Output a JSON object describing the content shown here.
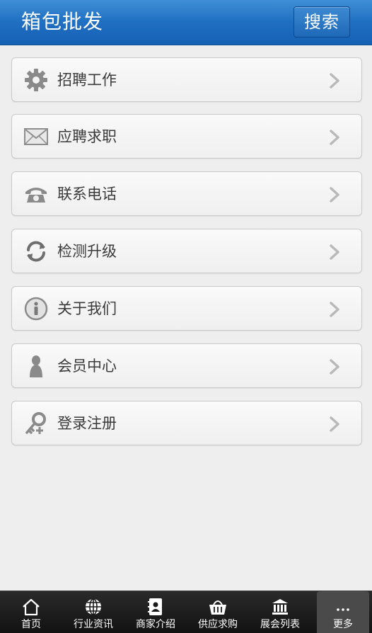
{
  "header": {
    "title": "箱包批发",
    "search_label": "搜索"
  },
  "menu": [
    {
      "label": "招聘工作",
      "icon": "gear-icon"
    },
    {
      "label": "应聘求职",
      "icon": "envelope-icon"
    },
    {
      "label": "联系电话",
      "icon": "telephone-icon"
    },
    {
      "label": "检测升级",
      "icon": "refresh-icon"
    },
    {
      "label": "关于我们",
      "icon": "info-icon"
    },
    {
      "label": "会员中心",
      "icon": "user-icon"
    },
    {
      "label": "登录注册",
      "icon": "key-icon"
    }
  ],
  "tabs": [
    {
      "label": "首页",
      "icon": "home-icon"
    },
    {
      "label": "行业资讯",
      "icon": "globe-icon"
    },
    {
      "label": "商家介绍",
      "icon": "contact-book-icon"
    },
    {
      "label": "供应求购",
      "icon": "basket-icon"
    },
    {
      "label": "展会列表",
      "icon": "building-icon"
    },
    {
      "label": "更多",
      "icon": "more-icon",
      "active": true
    }
  ],
  "colors": {
    "header": "#1f6fc2",
    "tabbar": "#1a1a1a",
    "background": "#eeeeee"
  }
}
